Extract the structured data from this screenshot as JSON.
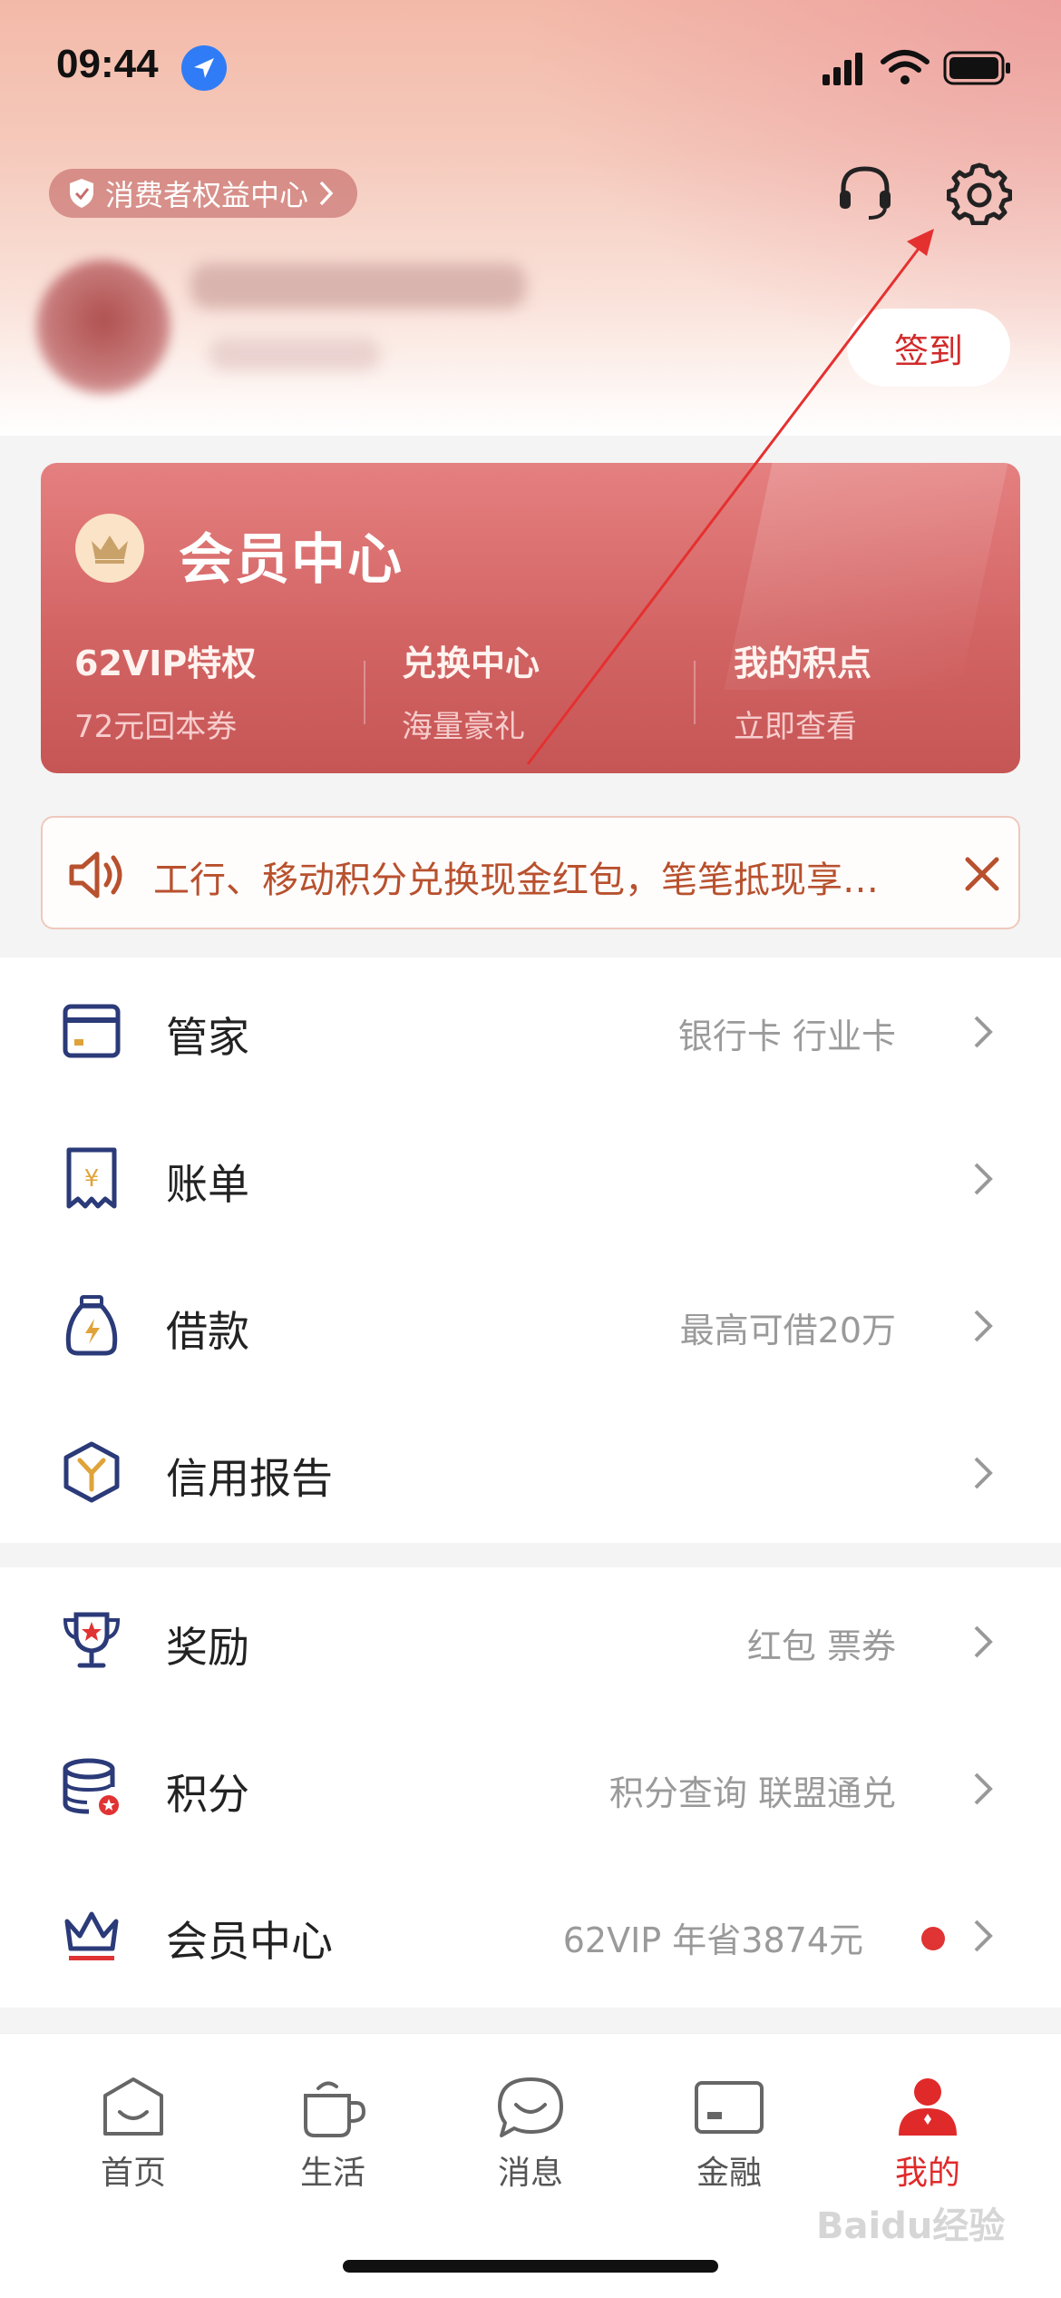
{
  "status_bar": {
    "time": "09:44"
  },
  "header": {
    "consumer_center": "消费者权益中心",
    "checkin": "签到"
  },
  "member_card": {
    "title": "会员中心",
    "items": [
      {
        "title": "62VIP特权",
        "subtitle": "72元回本券"
      },
      {
        "title": "兑换中心",
        "subtitle": "海量豪礼"
      },
      {
        "title": "我的积点",
        "subtitle": "立即查看"
      }
    ]
  },
  "notice": {
    "text": "工行、移动积分兑换现金红包，笔笔抵现享…"
  },
  "section1": [
    {
      "label": "管家",
      "right": "银行卡 行业卡",
      "icon": "card-icon"
    },
    {
      "label": "账单",
      "right": "",
      "icon": "bill-icon"
    },
    {
      "label": "借款",
      "right": "最高可借20万",
      "icon": "loan-bag-icon"
    },
    {
      "label": "信用报告",
      "right": "",
      "icon": "credit-report-icon"
    }
  ],
  "section2": [
    {
      "label": "奖励",
      "right": "红包 票券",
      "icon": "trophy-icon"
    },
    {
      "label": "积分",
      "right": "积分查询 联盟通兑",
      "icon": "points-coins-icon"
    },
    {
      "label": "会员中心",
      "right": "62VIP 年省3874元",
      "icon": "crown-icon",
      "dot": true
    }
  ],
  "tabbar": {
    "tabs": [
      {
        "label": "首页",
        "icon": "home-icon"
      },
      {
        "label": "生活",
        "icon": "life-cup-icon"
      },
      {
        "label": "消息",
        "icon": "message-icon"
      },
      {
        "label": "金融",
        "icon": "finance-card-icon"
      },
      {
        "label": "我的",
        "icon": "profile-icon",
        "active": true
      }
    ]
  },
  "watermark": "Baidu经验",
  "colors": {
    "accent": "#e02a2a",
    "card": "#d36464",
    "notice_text": "#b8512e",
    "navy_icon": "#2b3a78"
  }
}
